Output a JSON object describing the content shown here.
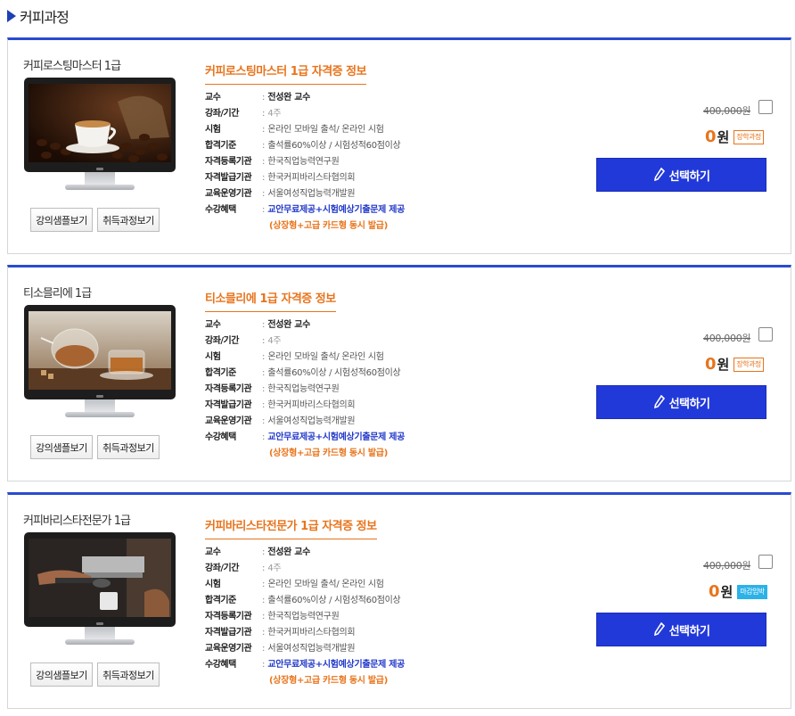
{
  "section": {
    "title": "커피과정"
  },
  "courses": [
    {
      "thumb_title": "커피로스팅마스터 1급",
      "info_title": "커피로스팅마스터 1급 자격증 정보",
      "sample_btn": "강의샘플보기",
      "info_btn": "취득과정보기",
      "rows": [
        {
          "label": "교수",
          "value": "전성완 교수"
        },
        {
          "label": "강좌/기간",
          "value": "4주"
        },
        {
          "label": "시험",
          "value": "온라인 모바일 출석/ 온라인 시험"
        },
        {
          "label": "합격기준",
          "value": "출석률60%이상 / 시험성적60점이상"
        },
        {
          "label": "자격등록기관",
          "value": "한국직업능력연구원"
        },
        {
          "label": "자격발급기관",
          "value": "한국커피바리스타협의회"
        },
        {
          "label": "교육운영기관",
          "value": "서울여성직업능력개발원"
        },
        {
          "label": "수강혜택",
          "value": "교안무료제공+시험예상기출문제 제공"
        }
      ],
      "benefit_note": "(상장형+고급 카드형 동시 발급)",
      "old_price": "400,000원",
      "price_zero": "0",
      "price_unit": "원",
      "badge": "장학과정",
      "select_btn": "선택하기"
    },
    {
      "thumb_title": "티소믈리에 1급",
      "info_title": "티소믈리에 1급 자격증 정보",
      "sample_btn": "강의샘플보기",
      "info_btn": "취득과정보기",
      "rows": [
        {
          "label": "교수",
          "value": "전성완 교수"
        },
        {
          "label": "강좌/기간",
          "value": "4주"
        },
        {
          "label": "시험",
          "value": "온라인 모바일 출석/ 온라인 시험"
        },
        {
          "label": "합격기준",
          "value": "출석률60%이상 / 시험성적60점이상"
        },
        {
          "label": "자격등록기관",
          "value": "한국직업능력연구원"
        },
        {
          "label": "자격발급기관",
          "value": "한국커피바리스타협의회"
        },
        {
          "label": "교육운영기관",
          "value": "서울여성직업능력개발원"
        },
        {
          "label": "수강혜택",
          "value": "교안무료제공+시험예상기출문제 제공"
        }
      ],
      "benefit_note": "(상장형+고급 카드형 동시 발급)",
      "old_price": "400,000원",
      "price_zero": "0",
      "price_unit": "원",
      "badge": "장학과정",
      "select_btn": "선택하기"
    },
    {
      "thumb_title": "커피바리스타전문가 1급",
      "info_title": "커피바리스타전문가 1급 자격증 정보",
      "sample_btn": "강의샘플보기",
      "info_btn": "취득과정보기",
      "rows": [
        {
          "label": "교수",
          "value": "전성완 교수"
        },
        {
          "label": "강좌/기간",
          "value": "4주"
        },
        {
          "label": "시험",
          "value": "온라인 모바일 출석/ 온라인 시험"
        },
        {
          "label": "합격기준",
          "value": "출석률60%이상 / 시험성적60점이상"
        },
        {
          "label": "자격등록기관",
          "value": "한국직업능력연구원"
        },
        {
          "label": "자격발급기관",
          "value": "한국커피바리스타협의회"
        },
        {
          "label": "교육운영기관",
          "value": "서울여성직업능력개발원"
        },
        {
          "label": "수강혜택",
          "value": "교안무료제공+시험예상기출문제 제공"
        }
      ],
      "benefit_note": "(상장형+고급 카드형 동시 발급)",
      "old_price": "400,000원",
      "price_zero": "0",
      "price_unit": "원",
      "badge": "마감임박",
      "select_btn": "선택하기"
    }
  ],
  "colors": {
    "accent_blue": "#2239d9",
    "accent_orange": "#e8741c",
    "badge_blue": "#2bb2e8"
  }
}
